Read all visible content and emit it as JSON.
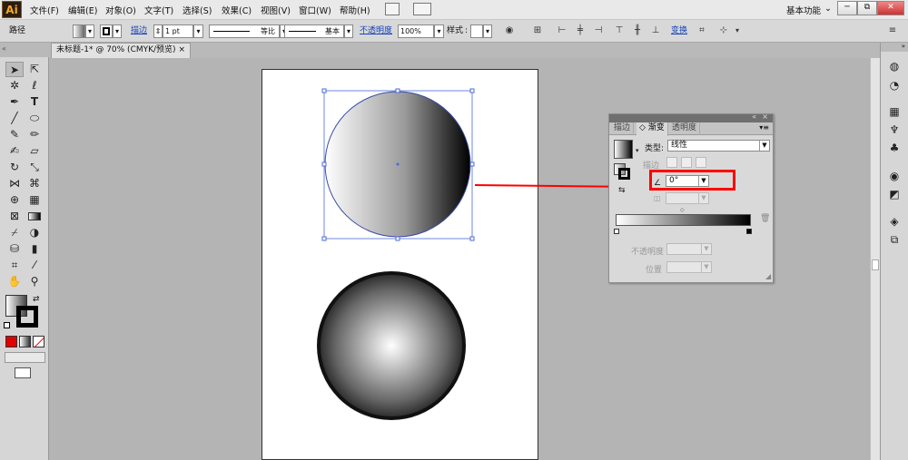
{
  "app": {
    "logo": "Ai",
    "workspace": "基本功能"
  },
  "menu": [
    "文件(F)",
    "编辑(E)",
    "对象(O)",
    "文字(T)",
    "选择(S)",
    "效果(C)",
    "视图(V)",
    "窗口(W)",
    "帮助(H)"
  ],
  "window_controls": {
    "minimize": "─",
    "restore": "⧉",
    "close": "✕"
  },
  "control_bar": {
    "object_type": "路径",
    "stroke_link": "描边",
    "stroke_weight": "1 pt",
    "profile_label": "等比",
    "brush_label": "基本",
    "opacity_link": "不透明度",
    "opacity_value": "100%",
    "style_label": "样式",
    "transform_link": "变换"
  },
  "document_tab": {
    "title": "未标题-1* @ 70% (CMYK/预览)",
    "close": "×"
  },
  "gradient_panel": {
    "tabs": [
      "描边",
      "渐变",
      "透明度"
    ],
    "type_label": "类型",
    "type_value": "线性",
    "stroke_label": "描边",
    "angle_value": "0°",
    "opacity_label": "不透明度",
    "location_label": "位置",
    "colors": {
      "highlight": "#ff0000",
      "arrow": "#ff0000"
    }
  },
  "colors": {
    "accent": "#ff0000",
    "link": "#1844b8"
  }
}
